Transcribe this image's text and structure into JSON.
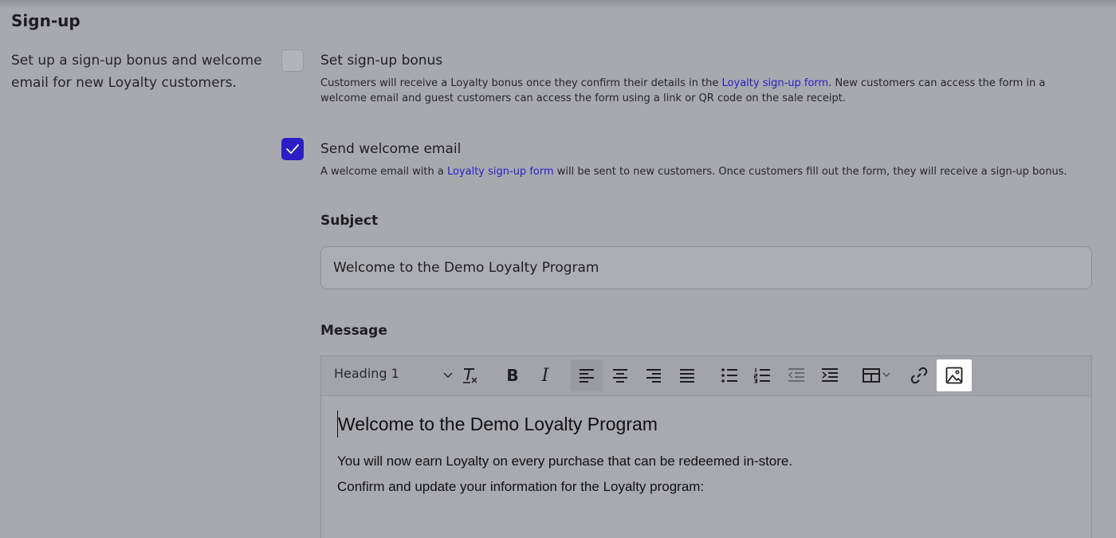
{
  "section": {
    "title": "Sign-up",
    "description": "Set up a sign-up bonus and welcome email for new Loyalty customers."
  },
  "options": {
    "bonus": {
      "label": "Set sign-up bonus",
      "checked": false,
      "desc_before": "Customers will receive a Loyalty bonus once they confirm their details in the ",
      "link": "Loyalty sign-up form",
      "desc_after": ". New customers can access the form in a welcome email and guest customers can access the form using a link or QR code on the sale receipt."
    },
    "welcome": {
      "label": "Send welcome email",
      "checked": true,
      "desc_before": "A welcome email with a ",
      "link": "Loyalty sign-up form",
      "desc_after": " will be sent to new customers. Once customers fill out the form, they will receive a sign-up bonus."
    }
  },
  "subject": {
    "label": "Subject",
    "value": "Welcome to the Demo Loyalty Program"
  },
  "message": {
    "label": "Message",
    "toolbar": {
      "heading_select": "Heading 1",
      "buttons": [
        "clear-format",
        "bold",
        "italic",
        "align-left",
        "align-center",
        "align-right",
        "align-justify",
        "bullet-list",
        "numbered-list",
        "outdent",
        "indent",
        "table",
        "link",
        "image"
      ]
    },
    "content": {
      "heading": "Welcome to the Demo Loyalty Program",
      "paragraphs": [
        "You will now earn Loyalty on every purchase that can be redeemed in-store.",
        "Confirm and update your information for the Loyalty program:"
      ]
    }
  },
  "colors": {
    "background": "#a8a9af",
    "accent": "#2a1ec4",
    "highlight": "#ffffff"
  }
}
